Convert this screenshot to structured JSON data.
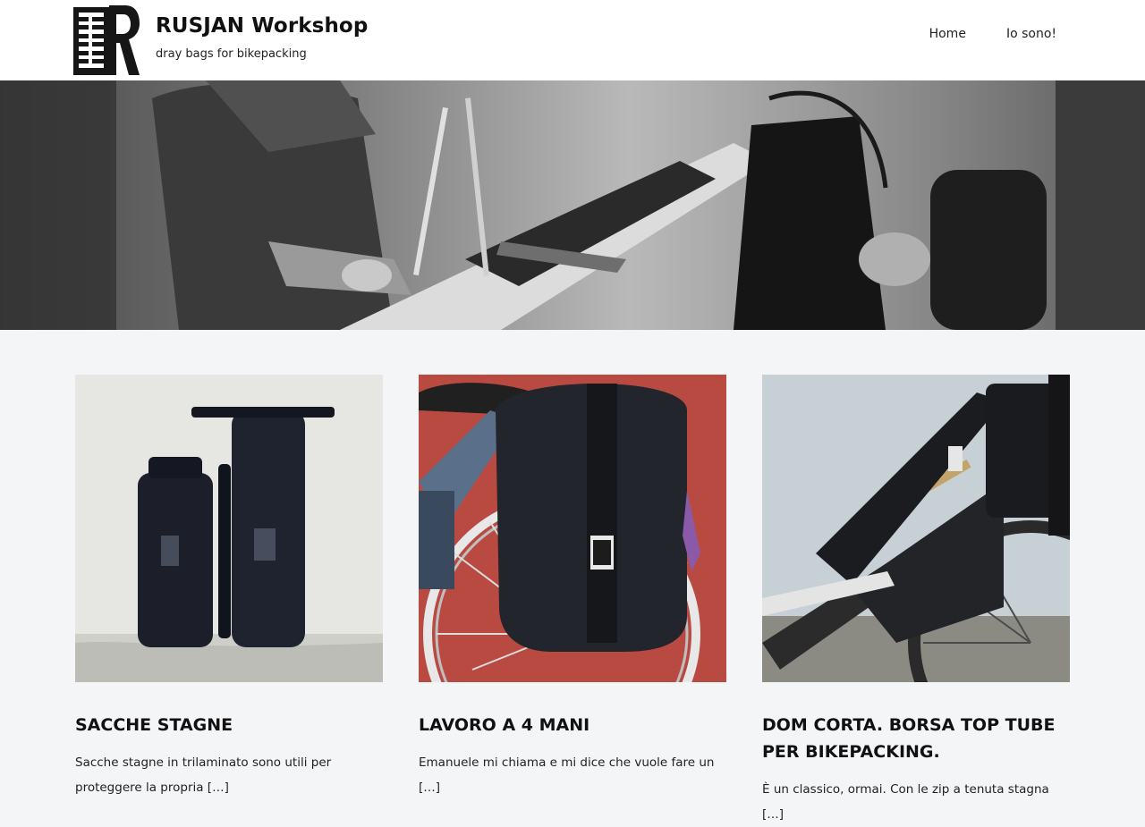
{
  "header": {
    "site_title": "RUSJAN Workshop",
    "tagline": "dray bags for bikepacking",
    "logo_text": "RUSJAN",
    "nav": [
      {
        "label": "Home"
      },
      {
        "label": "Io sono!"
      }
    ]
  },
  "hero": {
    "image_description_icon": "workshop-photo"
  },
  "posts": [
    {
      "title": "SACCHE STAGNE",
      "excerpt": "Sacche stagne in trilaminato sono utili per proteggere la propria […]"
    },
    {
      "title": "LAVORO A 4 MANI",
      "excerpt": "Emanuele mi chiama e mi dice che vuole fare un […]"
    },
    {
      "title": "DOM CORTA. BORSA TOP TUBE PER BIKEPACKING.",
      "excerpt": "È  un classico, ormai.  Con le zip a tenuta stagna […]"
    }
  ],
  "colors": {
    "header_bg": "#ffffff",
    "page_bg": "#f4f5f7",
    "text": "#222222"
  }
}
